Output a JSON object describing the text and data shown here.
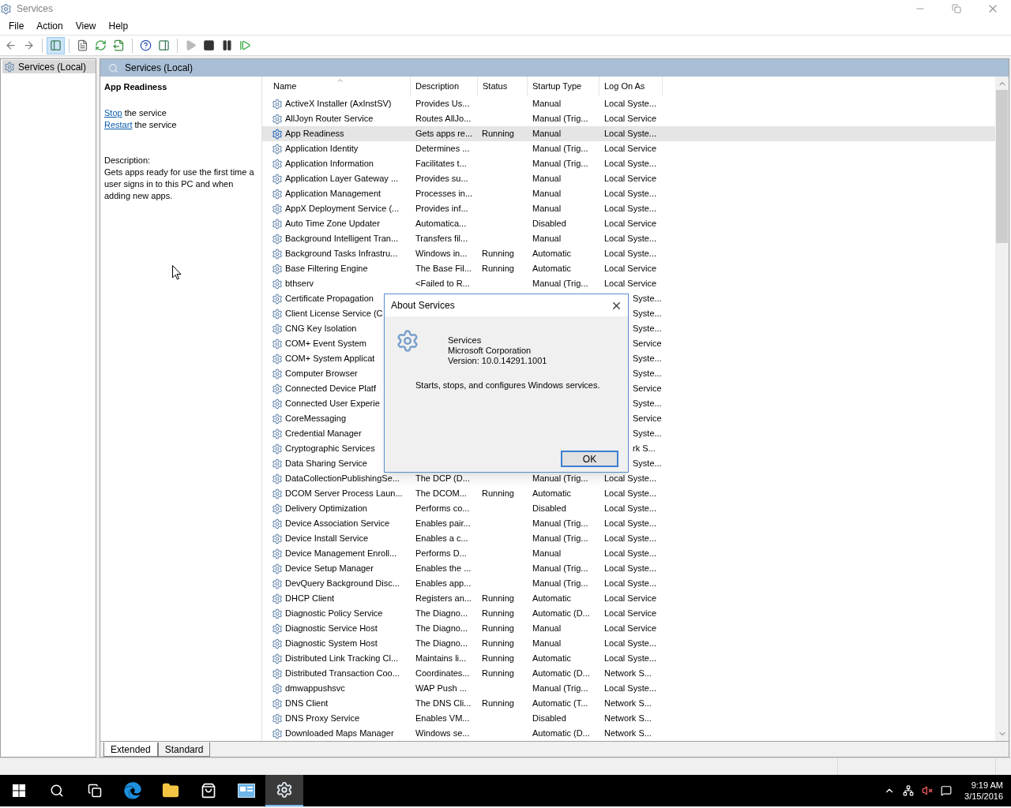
{
  "window": {
    "title": "Services"
  },
  "menu": [
    "File",
    "Action",
    "View",
    "Help"
  ],
  "toolbar_groups": [
    [
      {
        "kind": "back",
        "selected": false,
        "disabled": false
      },
      {
        "kind": "forward",
        "selected": false,
        "disabled": false
      }
    ],
    [
      {
        "kind": "console-tree",
        "selected": true,
        "disabled": false
      }
    ],
    [
      {
        "kind": "properties",
        "selected": false,
        "disabled": false
      },
      {
        "kind": "refresh",
        "selected": false,
        "disabled": false
      },
      {
        "kind": "export",
        "selected": false,
        "disabled": false
      }
    ],
    [
      {
        "kind": "help",
        "selected": false,
        "disabled": false
      },
      {
        "kind": "action-pane",
        "selected": false,
        "disabled": false
      }
    ],
    [
      {
        "kind": "start",
        "selected": false,
        "disabled": true
      },
      {
        "kind": "stop",
        "selected": false,
        "disabled": false
      },
      {
        "kind": "pause",
        "selected": false,
        "disabled": false
      },
      {
        "kind": "resume",
        "selected": false,
        "disabled": false
      }
    ]
  ],
  "tree": [
    {
      "label": "Services (Local)",
      "selected": true
    }
  ],
  "pane_header": "Services (Local)",
  "details": {
    "title": "App Readiness",
    "actions": [
      {
        "link": "Stop",
        "text": " the service"
      },
      {
        "link": "Restart",
        "text": " the service"
      }
    ],
    "description_label": "Description:",
    "description": "Gets apps ready for use the first time a user signs in to this PC and when adding new apps."
  },
  "table": {
    "columns": [
      {
        "label": "Name",
        "sorted": true
      },
      {
        "label": "Description",
        "sorted": false
      },
      {
        "label": "Status",
        "sorted": false
      },
      {
        "label": "Startup Type",
        "sorted": false
      },
      {
        "label": "Log On As",
        "sorted": false
      }
    ],
    "rows": [
      {
        "kind": "full",
        "selected": false,
        "name": "ActiveX Installer (AxInstSV)",
        "description": "Provides Us...",
        "startup": "Manual",
        "logon": "Local Syste..."
      },
      {
        "kind": "full",
        "selected": false,
        "name": "AllJoyn Router Service",
        "description": "Routes AllJo...",
        "startup": "Manual (Trig...",
        "logon": "Local Service"
      },
      {
        "kind": "full",
        "selected": true,
        "name": "App Readiness",
        "description": "Gets apps re...",
        "status": "Running",
        "startup": "Manual",
        "logon": "Local Syste..."
      },
      {
        "kind": "full",
        "selected": false,
        "name": "Application Identity",
        "description": "Determines ...",
        "startup": "Manual (Trig...",
        "logon": "Local Service"
      },
      {
        "kind": "full",
        "selected": false,
        "name": "Application Information",
        "description": "Facilitates t...",
        "startup": "Manual (Trig...",
        "logon": "Local Syste..."
      },
      {
        "kind": "full",
        "selected": false,
        "name": "Application Layer Gateway ...",
        "description": "Provides su...",
        "startup": "Manual",
        "logon": "Local Service"
      },
      {
        "kind": "full",
        "selected": false,
        "name": "Application Management",
        "description": "Processes in...",
        "startup": "Manual",
        "logon": "Local Syste..."
      },
      {
        "kind": "full",
        "selected": false,
        "name": "AppX Deployment Service (...",
        "description": "Provides inf...",
        "startup": "Manual",
        "logon": "Local Syste..."
      },
      {
        "kind": "full",
        "selected": false,
        "name": "Auto Time Zone Updater",
        "description": "Automatica...",
        "startup": "Disabled",
        "logon": "Local Service"
      },
      {
        "kind": "full",
        "selected": false,
        "name": "Background Intelligent Tran...",
        "description": "Transfers fil...",
        "startup": "Manual",
        "logon": "Local Syste..."
      },
      {
        "kind": "full",
        "selected": false,
        "name": "Background Tasks Infrastru...",
        "description": "Windows in...",
        "status": "Running",
        "startup": "Automatic",
        "logon": "Local Syste..."
      },
      {
        "kind": "full",
        "selected": false,
        "name": "Base Filtering Engine",
        "description": "The Base Fil...",
        "status": "Running",
        "startup": "Automatic",
        "logon": "Local Service"
      },
      {
        "kind": "full",
        "selected": false,
        "name": "bthserv",
        "description": "<Failed to R...",
        "startup": "Manual (Trig...",
        "logon": "Local Service"
      },
      {
        "kind": "occluded",
        "selected": false,
        "name": "Certificate Propagation",
        "logon": "Syste..."
      },
      {
        "kind": "occluded",
        "selected": false,
        "name": "Client License Service (C",
        "logon": "Syste..."
      },
      {
        "kind": "occluded",
        "selected": false,
        "name": "CNG Key Isolation",
        "logon": "Syste..."
      },
      {
        "kind": "occluded",
        "selected": false,
        "name": "COM+ Event System",
        "logon": "Service"
      },
      {
        "kind": "occluded",
        "selected": false,
        "name": "COM+ System Applicat",
        "logon": "Syste..."
      },
      {
        "kind": "occluded",
        "selected": false,
        "name": "Computer Browser",
        "logon": "Syste..."
      },
      {
        "kind": "occluded",
        "selected": false,
        "name": "Connected Device Platf",
        "logon": "Service"
      },
      {
        "kind": "occluded",
        "selected": false,
        "name": "Connected User Experie",
        "logon": "Syste..."
      },
      {
        "kind": "occluded",
        "selected": false,
        "name": "CoreMessaging",
        "logon": "Service"
      },
      {
        "kind": "occluded",
        "selected": false,
        "name": "Credential Manager",
        "logon": "Syste..."
      },
      {
        "kind": "occluded",
        "selected": false,
        "name": "Cryptographic Services",
        "logon": "rk S..."
      },
      {
        "kind": "occluded",
        "selected": false,
        "name": "Data Sharing Service",
        "logon": "Syste..."
      },
      {
        "kind": "full",
        "selected": false,
        "name": "DataCollectionPublishingSe...",
        "description": "The DCP (D...",
        "startup": "Manual (Trig...",
        "logon": "Local Syste..."
      },
      {
        "kind": "full",
        "selected": false,
        "name": "DCOM Server Process Laun...",
        "description": "The DCOM...",
        "status": "Running",
        "startup": "Automatic",
        "logon": "Local Syste..."
      },
      {
        "kind": "full",
        "selected": false,
        "name": "Delivery Optimization",
        "description": "Performs co...",
        "startup": "Disabled",
        "logon": "Local Syste..."
      },
      {
        "kind": "full",
        "selected": false,
        "name": "Device Association Service",
        "description": "Enables pair...",
        "startup": "Manual (Trig...",
        "logon": "Local Syste..."
      },
      {
        "kind": "full",
        "selected": false,
        "name": "Device Install Service",
        "description": "Enables a c...",
        "startup": "Manual (Trig...",
        "logon": "Local Syste..."
      },
      {
        "kind": "full",
        "selected": false,
        "name": "Device Management Enroll...",
        "description": "Performs D...",
        "startup": "Manual",
        "logon": "Local Syste..."
      },
      {
        "kind": "full",
        "selected": false,
        "name": "Device Setup Manager",
        "description": "Enables the ...",
        "startup": "Manual (Trig...",
        "logon": "Local Syste..."
      },
      {
        "kind": "full",
        "selected": false,
        "name": "DevQuery Background Disc...",
        "description": "Enables app...",
        "startup": "Manual (Trig...",
        "logon": "Local Syste..."
      },
      {
        "kind": "full",
        "selected": false,
        "name": "DHCP Client",
        "description": "Registers an...",
        "status": "Running",
        "startup": "Automatic",
        "logon": "Local Service"
      },
      {
        "kind": "full",
        "selected": false,
        "name": "Diagnostic Policy Service",
        "description": "The Diagno...",
        "status": "Running",
        "startup": "Automatic (D...",
        "logon": "Local Service"
      },
      {
        "kind": "full",
        "selected": false,
        "name": "Diagnostic Service Host",
        "description": "The Diagno...",
        "status": "Running",
        "startup": "Manual",
        "logon": "Local Service"
      },
      {
        "kind": "full",
        "selected": false,
        "name": "Diagnostic System Host",
        "description": "The Diagno...",
        "status": "Running",
        "startup": "Manual",
        "logon": "Local Syste..."
      },
      {
        "kind": "full",
        "selected": false,
        "name": "Distributed Link Tracking Cl...",
        "description": "Maintains li...",
        "status": "Running",
        "startup": "Automatic",
        "logon": "Local Syste..."
      },
      {
        "kind": "full",
        "selected": false,
        "name": "Distributed Transaction Coo...",
        "description": "Coordinates...",
        "status": "Running",
        "startup": "Automatic (D...",
        "logon": "Network S..."
      },
      {
        "kind": "full",
        "selected": false,
        "name": "dmwappushsvc",
        "description": "WAP Push ...",
        "startup": "Manual (Trig...",
        "logon": "Local Syste..."
      },
      {
        "kind": "full",
        "selected": false,
        "name": "DNS Client",
        "description": "The DNS Cli...",
        "status": "Running",
        "startup": "Automatic (T...",
        "logon": "Network S..."
      },
      {
        "kind": "full",
        "selected": false,
        "name": "DNS Proxy Service",
        "description": "Enables VM...",
        "startup": "Disabled",
        "logon": "Network S..."
      },
      {
        "kind": "full",
        "selected": false,
        "name": "Downloaded Maps Manager",
        "description": "Windows se...",
        "startup": "Automatic (D...",
        "logon": "Network S..."
      }
    ]
  },
  "view_tabs": [
    {
      "label": "Extended",
      "selected": true
    },
    {
      "label": "Standard",
      "selected": false
    }
  ],
  "dialog": {
    "title": "About Services",
    "product": "Services",
    "company": "Microsoft Corporation",
    "version": "Version: 10.0.14291.1001",
    "description": "Starts, stops, and configures Windows services.",
    "button": "OK"
  },
  "taskbar": {
    "items": [
      {
        "kind": "start",
        "selected": false
      },
      {
        "kind": "search",
        "selected": false
      },
      {
        "kind": "task-view",
        "selected": false
      },
      {
        "kind": "edge",
        "selected": false
      },
      {
        "kind": "explorer",
        "selected": false
      },
      {
        "kind": "store",
        "selected": false
      },
      {
        "kind": "control-panel",
        "selected": false
      },
      {
        "kind": "services",
        "selected": true
      }
    ],
    "tray": [
      {
        "kind": "chevron"
      },
      {
        "kind": "network"
      },
      {
        "kind": "volume-muted"
      },
      {
        "kind": "notifications"
      }
    ],
    "time": "9:19 AM",
    "date": "3/15/2016"
  }
}
